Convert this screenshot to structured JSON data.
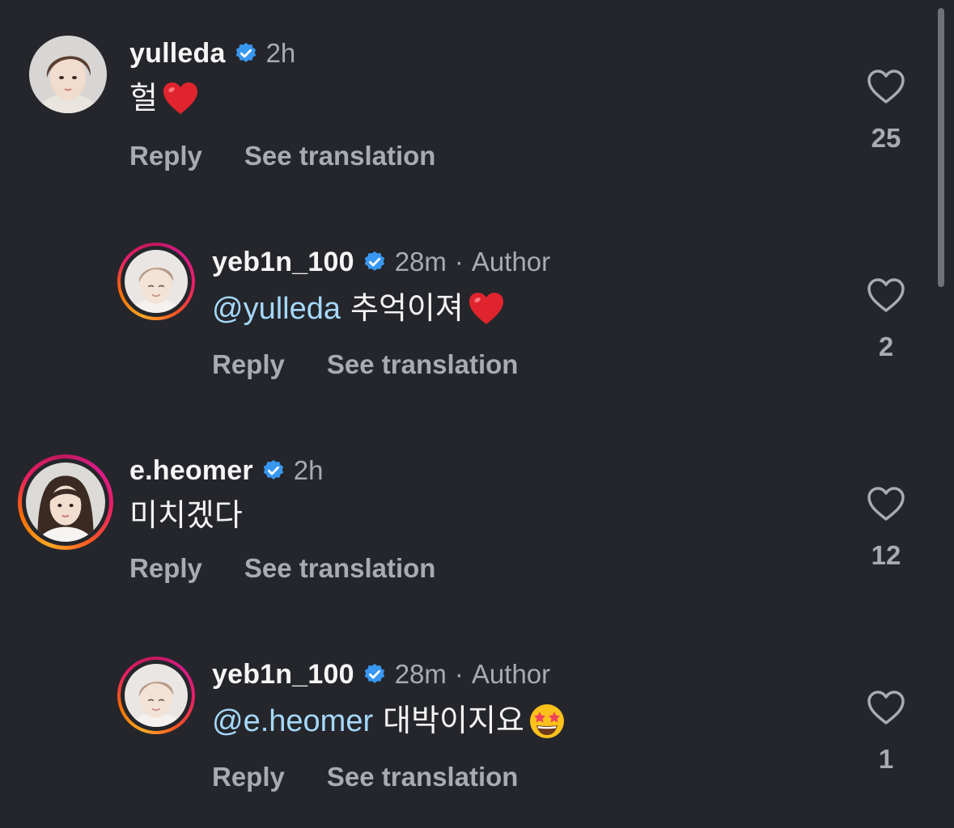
{
  "comments": [
    {
      "username": "yulleda",
      "time": "2h",
      "author_tag": "",
      "mention": "",
      "text": "헐",
      "emoji": "red-heart",
      "reply_label": "Reply",
      "translate_label": "See translation",
      "likes": "25",
      "avatar": "female-portrait-short-hair"
    },
    {
      "username": "yeb1n_100",
      "time": "28m",
      "author_tag": "Author",
      "mention": "@yulleda",
      "text": "추억이져",
      "emoji": "red-heart",
      "reply_label": "Reply",
      "translate_label": "See translation",
      "likes": "2",
      "avatar": "female-portrait-story-ring"
    },
    {
      "username": "e.heomer",
      "time": "2h",
      "author_tag": "",
      "mention": "",
      "text": "미치겠다",
      "emoji": "",
      "reply_label": "Reply",
      "translate_label": "See translation",
      "likes": "12",
      "avatar": "female-portrait-long-hair-story-ring"
    },
    {
      "username": "yeb1n_100",
      "time": "28m",
      "author_tag": "Author",
      "mention": "@e.heomer",
      "text": "대박이지요",
      "emoji": "star-struck",
      "reply_label": "Reply",
      "translate_label": "See translation",
      "likes": "1",
      "avatar": "female-portrait-story-ring"
    }
  ],
  "colors": {
    "background": "#24262b",
    "mention": "#a5d8fb",
    "secondary_text": "#a8abb2",
    "verified_badge": "#3897f0"
  },
  "icons": {
    "verified": "verified-badge-icon",
    "like": "heart-outline-icon"
  }
}
